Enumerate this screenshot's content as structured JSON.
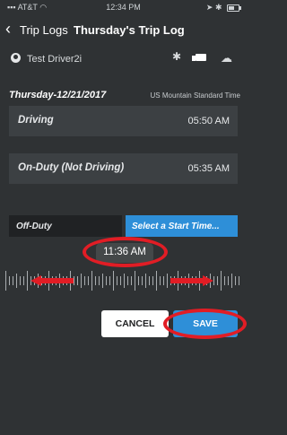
{
  "status_bar": {
    "carrier": "AT&T",
    "time": "12:34 PM"
  },
  "nav": {
    "back_label": "Trip Logs",
    "title": "Thursday's Trip Log"
  },
  "driver": {
    "name": "Test Driver2i",
    "icons": [
      "bluetooth-icon",
      "truck-icon",
      "cloud-icon"
    ]
  },
  "log": {
    "date": "Thursday-12/21/2017",
    "timezone": "US Mountain Standard Time",
    "entries": [
      {
        "status": "Driving",
        "time": "05:50 AM"
      },
      {
        "status": "On-Duty (Not Driving)",
        "time": "05:35 AM"
      }
    ]
  },
  "editor": {
    "status_label": "Off-Duty",
    "start_time_placeholder": "Select a Start Time...",
    "picker_time": "11:36 AM"
  },
  "buttons": {
    "cancel": "CANCEL",
    "save": "SAVE"
  },
  "colors": {
    "background": "#2f3234",
    "accent": "#2e8fd8",
    "annotation": "#e11d25"
  }
}
